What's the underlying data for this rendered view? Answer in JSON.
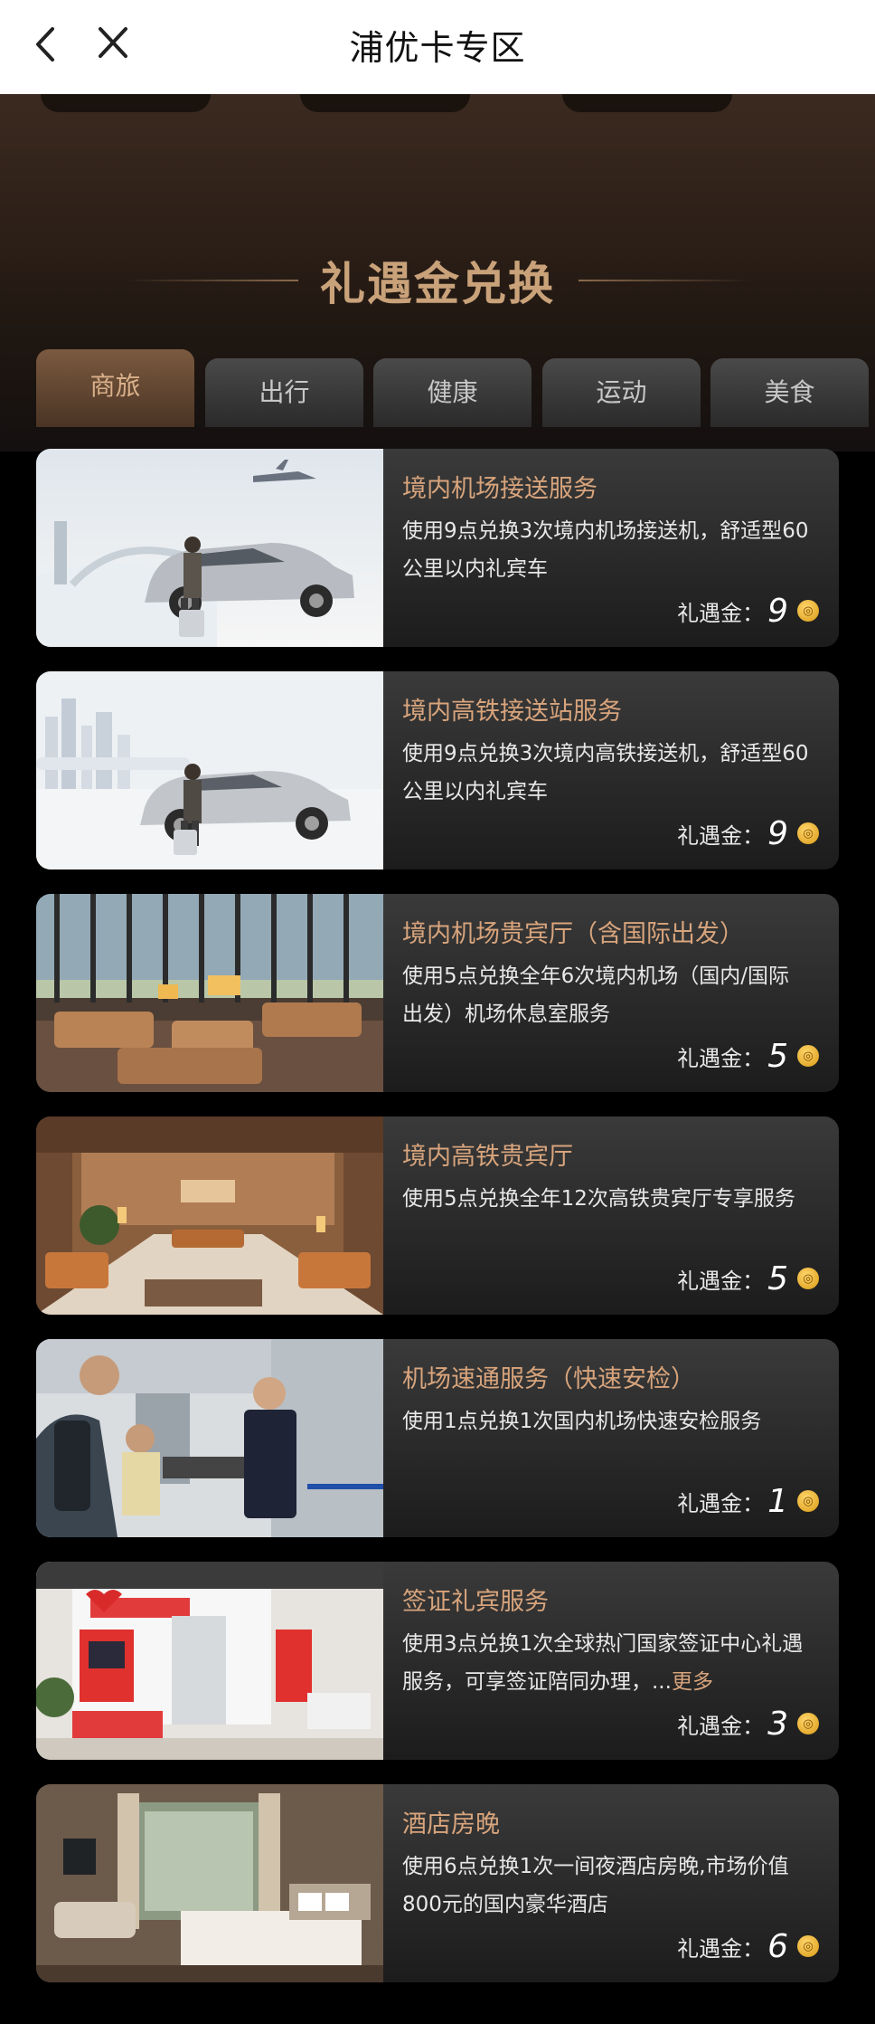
{
  "header": {
    "title": "浦优卡专区"
  },
  "section": {
    "title": "礼遇金兑换"
  },
  "tabs": [
    {
      "label": "商旅",
      "active": true
    },
    {
      "label": "出行",
      "active": false
    },
    {
      "label": "健康",
      "active": false
    },
    {
      "label": "运动",
      "active": false
    },
    {
      "label": "美食",
      "active": false
    }
  ],
  "price_label": "礼遇金：",
  "colors": {
    "accent": "#d8a47c",
    "coin": "#e0a21c"
  },
  "items": [
    {
      "title": "境内机场接送服务",
      "desc": "使用9点兑换3次境内机场接送机，舒适型60公里以内礼宾车",
      "more": "",
      "price": "9",
      "icon": "airport-car-image"
    },
    {
      "title": "境内高铁接送站服务",
      "desc": "使用9点兑换3次境内高铁接送机，舒适型60公里以内礼宾车",
      "more": "",
      "price": "9",
      "icon": "train-car-image"
    },
    {
      "title": "境内机场贵宾厅（含国际出发）",
      "desc": "使用5点兑换全年6次境内机场（国内/国际出发）机场休息室服务",
      "more": "",
      "price": "5",
      "icon": "airport-lounge-image"
    },
    {
      "title": "境内高铁贵宾厅",
      "desc": "使用5点兑换全年12次高铁贵宾厅专享服务",
      "more": "",
      "price": "5",
      "icon": "train-lounge-image"
    },
    {
      "title": "机场速通服务（快速安检）",
      "desc": "使用1点兑换1次国内机场快速安检服务",
      "more": "",
      "price": "1",
      "icon": "security-check-image"
    },
    {
      "title": "签证礼宾服务",
      "desc": "使用3点兑换1次全球热门国家签证中心礼遇服务，可享签证陪同办理，...",
      "more": "更多",
      "price": "3",
      "icon": "visa-center-image"
    },
    {
      "title": "酒店房晚",
      "desc": "使用6点兑换1次一间夜酒店房晚,市场价值800元的国内豪华酒店",
      "more": "",
      "price": "6",
      "icon": "hotel-room-image"
    }
  ]
}
